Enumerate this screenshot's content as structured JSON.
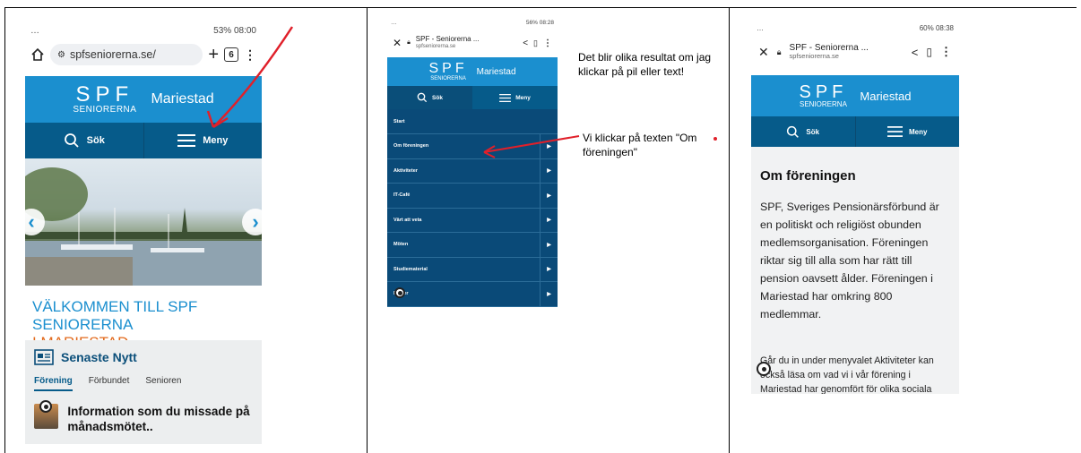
{
  "phone1": {
    "status_right": "53% 08:00",
    "status_left": "…",
    "url": "spfseniorerna.se/",
    "tab_count": "6",
    "logo_top": "SPF",
    "logo_bottom": "SENIORERNA",
    "place": "Mariestad",
    "search_label": "Sök",
    "menu_label": "Meny",
    "welcome_line1": "VÄLKOMMEN TILL SPF",
    "welcome_line2": "SENIORERNA",
    "welcome_line3": "I MARIESTAD",
    "news_heading": "Senaste Nytt",
    "news_tabs": [
      "Förening",
      "Förbundet",
      "Senioren"
    ],
    "news_item_title": "Information som du missade på månadsmötet.."
  },
  "phone2": {
    "status_right": "56% 08:28",
    "status_left": "…",
    "page_title": "SPF - Seniorerna ...",
    "page_domain": "spfseniorerna.se",
    "logo_top": "SPF",
    "logo_bottom": "SENIORERNA",
    "place": "Mariestad",
    "search_label": "Sök",
    "menu_label": "Meny",
    "menu_items": [
      "Start",
      "Om föreningen",
      "Aktiviteter",
      "IT-Café",
      "Värt att veta",
      "Möten",
      "Studiematerial",
      "F   ner"
    ]
  },
  "phone3": {
    "status_right": "60% 08:38",
    "status_left": "…",
    "page_title": "SPF - Seniorerna ...",
    "page_domain": "spfseniorerna.se",
    "logo_top": "SPF",
    "logo_bottom": "SENIORERNA",
    "place": "Mariestad",
    "search_label": "Sök",
    "menu_label": "Meny",
    "heading": "Om föreningen",
    "body": "SPF, Sveriges Pensionärsförbund är en politiskt och religiöst obunden medlemsorganisation. Föreningen riktar sig till alla som har rätt till pension oavsett ålder. Föreningen i Mariestad har omkring 800 medlemmar.",
    "body2": "Går du in under menyvalet Aktiviteter kan också läsa om vad vi i vår förening i Mariestad har genomfört för olika sociala"
  },
  "notes": {
    "note1": "Det blir olika resultat om jag klickar på pil eller text!",
    "note2": "Vi klickar på texten \"Om föreningen\""
  },
  "colors": {
    "brand_blue": "#1b8fcf",
    "dark_blue": "#065b8a",
    "orange": "#e26a1d",
    "annotation_red": "#e0202a"
  }
}
